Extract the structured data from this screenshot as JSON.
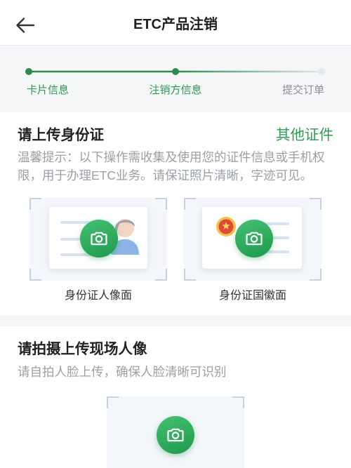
{
  "header": {
    "title": "ETC产品注销",
    "back_icon": "arrow-left-icon"
  },
  "progress": {
    "steps": [
      {
        "label": "卡片信息",
        "state": "done"
      },
      {
        "label": "注销方信息",
        "state": "current"
      },
      {
        "label": "提交订单",
        "state": "pending"
      }
    ]
  },
  "id_section": {
    "title": "请上传身份证",
    "other_link": "其他证件",
    "hint": "温馨提示：以下操作需收集及使用您的证件信息或手机权限，用于办理ETC业务。请保证照片清晰，字迹可见。",
    "front_label": "身份证人像面",
    "back_label": "身份证国徽面",
    "upload_icon": "camera-icon"
  },
  "face_section": {
    "title": "请拍摄上传现场人像",
    "hint": "请自拍人脸上传，确保人脸清晰可识别",
    "upload_icon": "camera-icon"
  },
  "colors": {
    "accent": "#2e9a4f",
    "progress_pending": "#dfe3e7",
    "background": "#f4f6f8"
  }
}
